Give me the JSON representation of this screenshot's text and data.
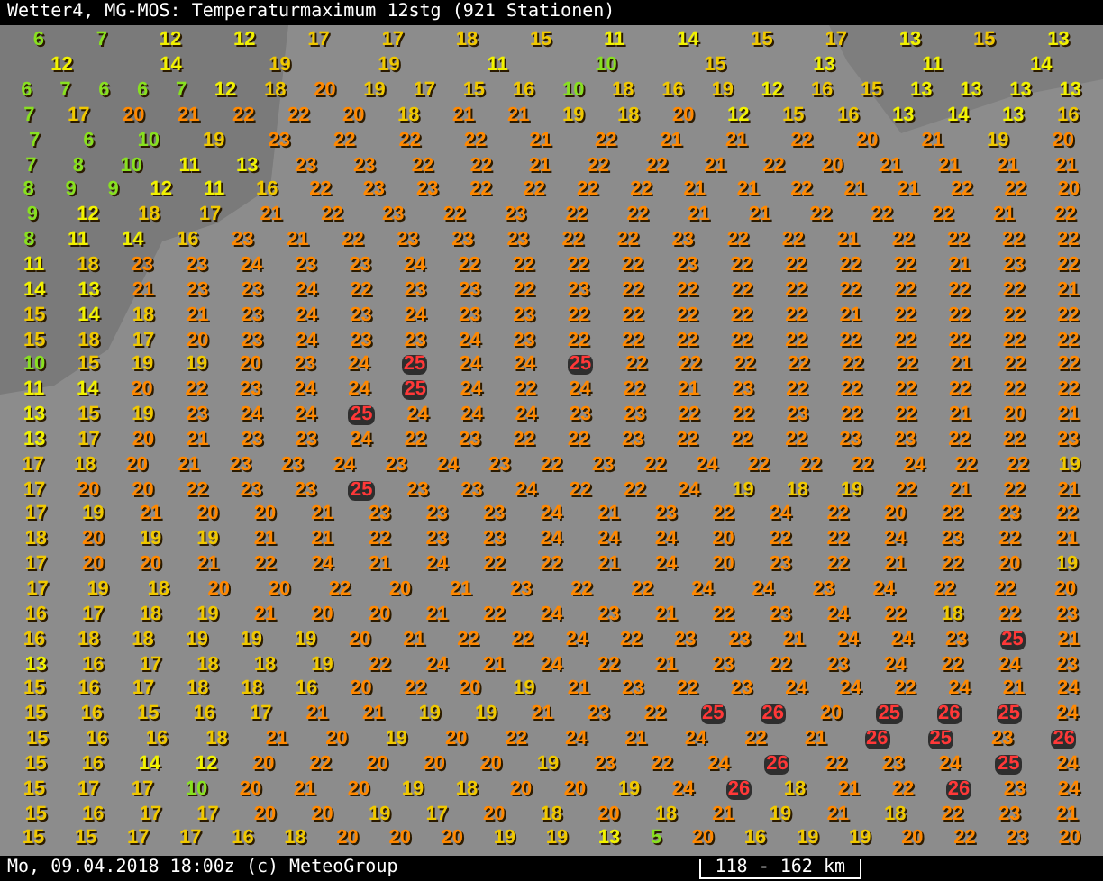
{
  "title": "Wetter4, MG-MOS: Temperaturmaximum 12stg (921 Stationen)",
  "station_rows": [
    [
      "6",
      "7",
      "12",
      "12",
      "17",
      "17",
      "18",
      "15",
      "11",
      "14",
      "15",
      "17",
      "13",
      "15",
      "13"
    ],
    [
      "12",
      "14",
      "19",
      "19",
      "11",
      "10",
      "15",
      "13",
      "11",
      "14"
    ],
    [
      "6",
      "7",
      "6",
      "6",
      "7",
      "12",
      "18",
      "20",
      "19",
      "17",
      "15",
      "16",
      "10",
      "18",
      "16",
      "19",
      "12",
      "16",
      "15",
      "13",
      "13",
      "13",
      "13"
    ],
    [
      "7",
      "17",
      "20",
      "21",
      "22",
      "22",
      "20",
      "18",
      "21",
      "21",
      "19",
      "18",
      "20",
      "12",
      "15",
      "16",
      "13",
      "14",
      "13",
      "16"
    ],
    [
      "7",
      "6",
      "10",
      "19",
      "23",
      "22",
      "22",
      "22",
      "21",
      "22",
      "21",
      "21",
      "22",
      "20",
      "21",
      "19",
      "20"
    ],
    [
      "7",
      "8",
      "10",
      "11",
      "13",
      "23",
      "23",
      "22",
      "22",
      "21",
      "22",
      "22",
      "21",
      "22",
      "20",
      "21",
      "21",
      "21",
      "21"
    ],
    [
      "8",
      "9",
      "9",
      "12",
      "11",
      "16",
      "22",
      "23",
      "23",
      "22",
      "22",
      "22",
      "22",
      "21",
      "21",
      "22",
      "21",
      "21",
      "22",
      "22",
      "20"
    ],
    [
      "9",
      "12",
      "18",
      "17",
      "21",
      "22",
      "23",
      "22",
      "23",
      "22",
      "22",
      "21",
      "21",
      "22",
      "22",
      "22",
      "21",
      "22"
    ],
    [
      "8",
      "11",
      "14",
      "16",
      "23",
      "21",
      "22",
      "23",
      "23",
      "23",
      "22",
      "22",
      "23",
      "22",
      "22",
      "21",
      "22",
      "22",
      "22",
      "22"
    ],
    [
      "11",
      "18",
      "23",
      "23",
      "24",
      "23",
      "23",
      "24",
      "22",
      "22",
      "22",
      "22",
      "23",
      "22",
      "22",
      "22",
      "22",
      "21",
      "23",
      "22"
    ],
    [
      "14",
      "13",
      "21",
      "23",
      "23",
      "24",
      "22",
      "23",
      "23",
      "22",
      "23",
      "22",
      "22",
      "22",
      "22",
      "22",
      "22",
      "22",
      "22",
      "21"
    ],
    [
      "15",
      "14",
      "18",
      "21",
      "23",
      "24",
      "23",
      "24",
      "23",
      "23",
      "22",
      "22",
      "22",
      "22",
      "22",
      "21",
      "22",
      "22",
      "22",
      "22"
    ],
    [
      "15",
      "18",
      "17",
      "20",
      "23",
      "24",
      "23",
      "23",
      "24",
      "23",
      "22",
      "22",
      "22",
      "22",
      "22",
      "22",
      "22",
      "22",
      "22",
      "22"
    ],
    [
      "10",
      "15",
      "19",
      "19",
      "20",
      "23",
      "24",
      "25",
      "24",
      "24",
      "25",
      "22",
      "22",
      "22",
      "22",
      "22",
      "22",
      "21",
      "22",
      "22"
    ],
    [
      "11",
      "14",
      "20",
      "22",
      "23",
      "24",
      "24",
      "25",
      "24",
      "22",
      "24",
      "22",
      "21",
      "23",
      "22",
      "22",
      "22",
      "22",
      "22",
      "22"
    ],
    [
      "13",
      "15",
      "19",
      "23",
      "24",
      "24",
      "25",
      "24",
      "24",
      "24",
      "23",
      "23",
      "22",
      "22",
      "23",
      "22",
      "22",
      "21",
      "20",
      "21"
    ],
    [
      "13",
      "17",
      "20",
      "21",
      "23",
      "23",
      "24",
      "22",
      "23",
      "22",
      "22",
      "23",
      "22",
      "22",
      "22",
      "23",
      "23",
      "22",
      "22",
      "23"
    ],
    [
      "17",
      "18",
      "20",
      "21",
      "23",
      "23",
      "24",
      "23",
      "24",
      "23",
      "22",
      "23",
      "22",
      "24",
      "22",
      "22",
      "22",
      "24",
      "22",
      "22",
      "19"
    ],
    [
      "17",
      "20",
      "20",
      "22",
      "23",
      "23",
      "25",
      "23",
      "23",
      "24",
      "22",
      "22",
      "24",
      "19",
      "18",
      "19",
      "22",
      "21",
      "22",
      "21"
    ],
    [
      "17",
      "19",
      "21",
      "20",
      "20",
      "21",
      "23",
      "23",
      "23",
      "24",
      "21",
      "23",
      "22",
      "24",
      "22",
      "20",
      "22",
      "23",
      "22"
    ],
    [
      "18",
      "20",
      "19",
      "19",
      "21",
      "21",
      "22",
      "23",
      "23",
      "24",
      "24",
      "24",
      "20",
      "22",
      "22",
      "24",
      "23",
      "22",
      "21"
    ],
    [
      "17",
      "20",
      "20",
      "21",
      "22",
      "24",
      "21",
      "24",
      "22",
      "22",
      "21",
      "24",
      "20",
      "23",
      "22",
      "21",
      "22",
      "20",
      "19"
    ],
    [
      "17",
      "19",
      "18",
      "20",
      "20",
      "22",
      "20",
      "21",
      "23",
      "22",
      "22",
      "24",
      "24",
      "23",
      "24",
      "22",
      "22",
      "20"
    ],
    [
      "16",
      "17",
      "18",
      "19",
      "21",
      "20",
      "20",
      "21",
      "22",
      "24",
      "23",
      "21",
      "22",
      "23",
      "24",
      "22",
      "18",
      "22",
      "23"
    ],
    [
      "16",
      "18",
      "18",
      "19",
      "19",
      "19",
      "20",
      "21",
      "22",
      "22",
      "24",
      "22",
      "23",
      "23",
      "21",
      "24",
      "24",
      "23",
      "25",
      "21"
    ],
    [
      "13",
      "16",
      "17",
      "18",
      "18",
      "19",
      "22",
      "24",
      "21",
      "24",
      "22",
      "21",
      "23",
      "22",
      "23",
      "24",
      "22",
      "24",
      "23"
    ],
    [
      "15",
      "16",
      "17",
      "18",
      "18",
      "16",
      "20",
      "22",
      "20",
      "19",
      "21",
      "23",
      "22",
      "23",
      "24",
      "24",
      "22",
      "24",
      "21",
      "24"
    ],
    [
      "15",
      "16",
      "15",
      "16",
      "17",
      "21",
      "21",
      "19",
      "19",
      "21",
      "23",
      "22",
      "25",
      "26",
      "20",
      "25",
      "26",
      "25",
      "24"
    ],
    [
      "15",
      "16",
      "16",
      "18",
      "21",
      "20",
      "19",
      "20",
      "22",
      "24",
      "21",
      "24",
      "22",
      "21",
      "26",
      "25",
      "23",
      "26"
    ],
    [
      "15",
      "16",
      "14",
      "12",
      "20",
      "22",
      "20",
      "20",
      "20",
      "19",
      "23",
      "22",
      "24",
      "26",
      "22",
      "23",
      "24",
      "25",
      "24"
    ],
    [
      "15",
      "17",
      "17",
      "10",
      "20",
      "21",
      "20",
      "19",
      "18",
      "20",
      "20",
      "19",
      "24",
      "26",
      "18",
      "21",
      "22",
      "26",
      "23",
      "24"
    ],
    [
      "15",
      "16",
      "17",
      "17",
      "20",
      "20",
      "19",
      "17",
      "20",
      "18",
      "20",
      "18",
      "21",
      "19",
      "21",
      "18",
      "22",
      "23",
      "21"
    ],
    [
      "15",
      "15",
      "17",
      "17",
      "16",
      "18",
      "20",
      "20",
      "20",
      "19",
      "19",
      "13",
      "5",
      "20",
      "16",
      "19",
      "19",
      "20",
      "22",
      "23",
      "20"
    ]
  ],
  "footer": {
    "timestamp": "Mo, 09.04.2018 18:00z (c) MeteoGroup",
    "scale": "118 - 162 km"
  }
}
